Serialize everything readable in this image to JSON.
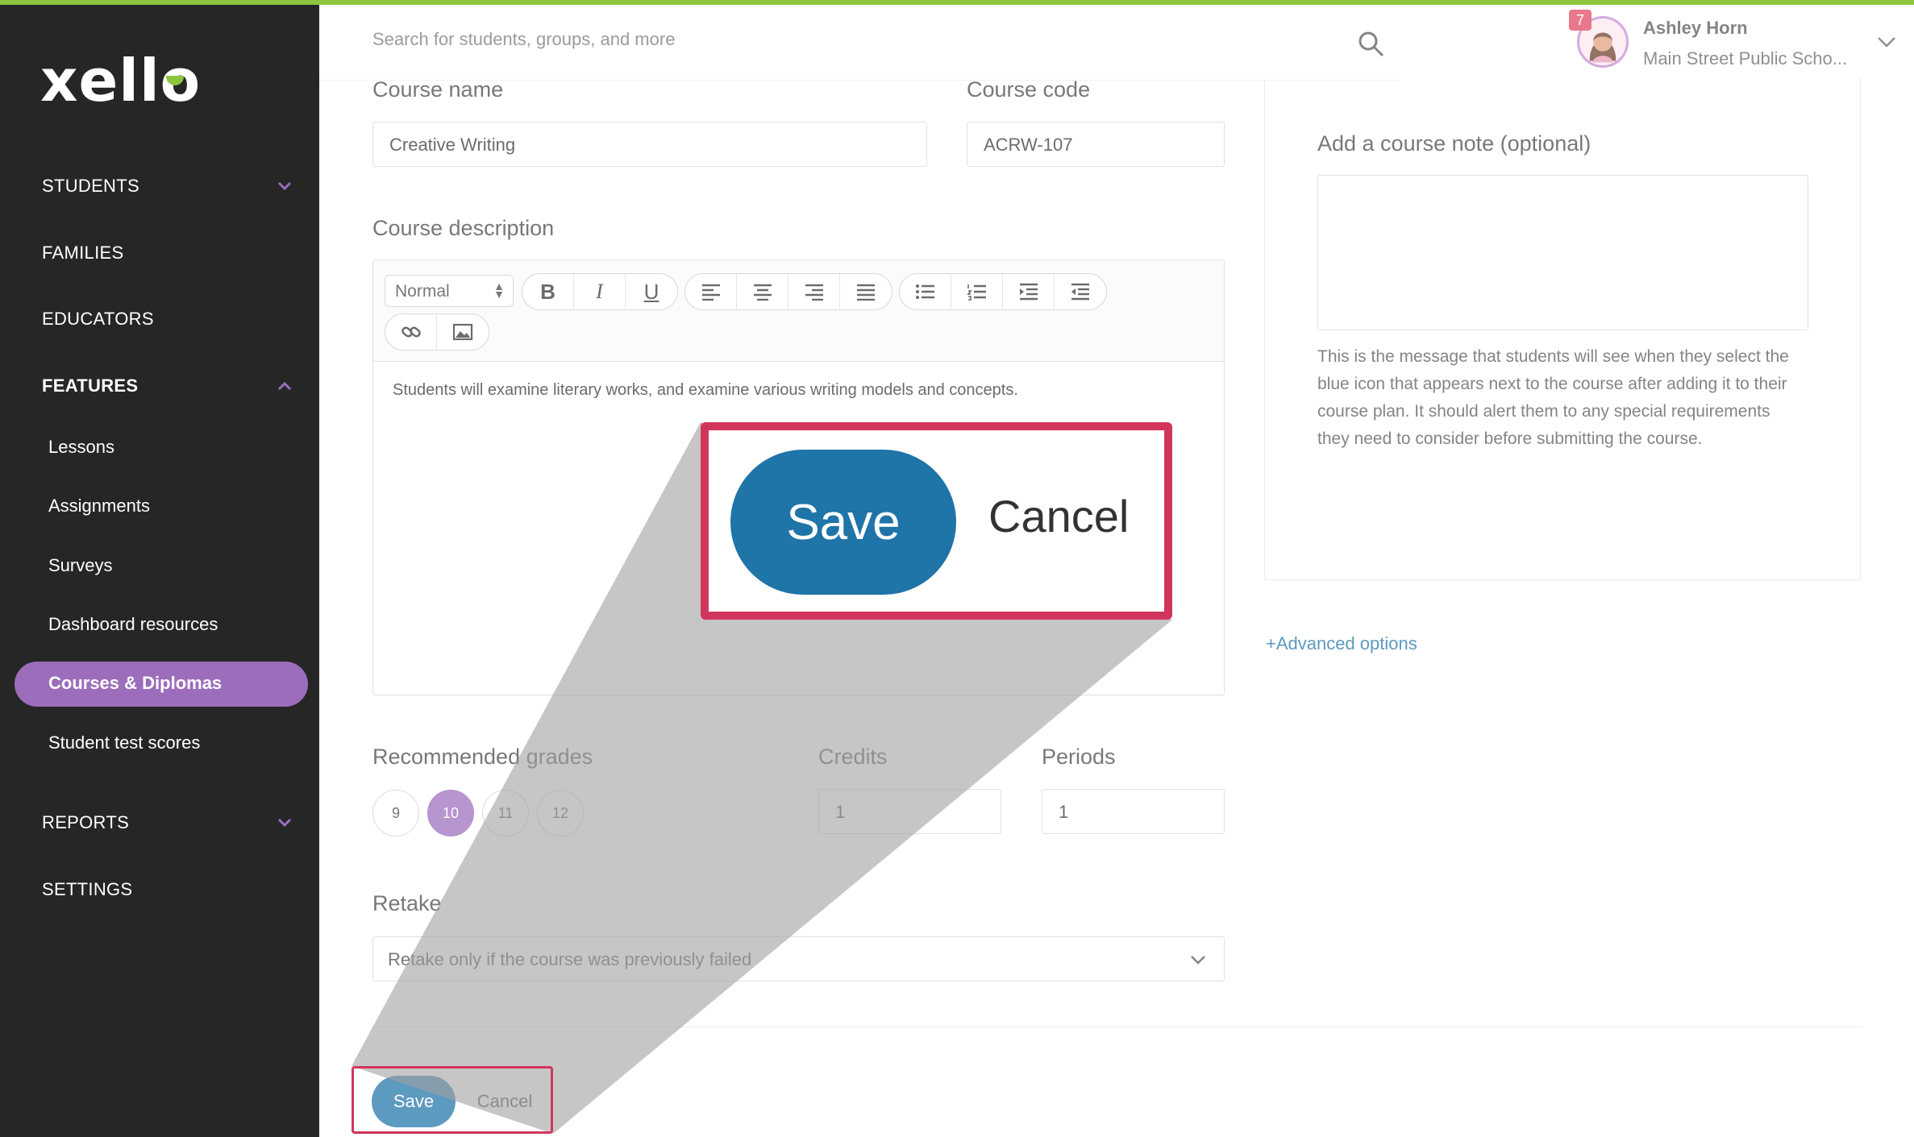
{
  "app": {
    "logo": "xello"
  },
  "search": {
    "placeholder": "Search for students, groups, and more"
  },
  "user": {
    "name": "Ashley Horn",
    "school": "Main Street Public Scho...",
    "notifications": "7"
  },
  "sidebar": {
    "sections": {
      "students": "STUDENTS",
      "families": "FAMILIES",
      "educators": "EDUCATORS",
      "features": "FEATURES",
      "reports": "REPORTS",
      "settings": "SETTINGS"
    },
    "features_items": [
      "Lessons",
      "Assignments",
      "Surveys",
      "Dashboard resources",
      "Courses & Diplomas",
      "Student test scores"
    ],
    "active_item": "Courses & Diplomas"
  },
  "form": {
    "course_name_label": "Course name",
    "course_name_value": "Creative Writing",
    "course_code_label": "Course code",
    "course_code_value": "ACRW-107",
    "description_label": "Course description",
    "toolbar_style": "Normal",
    "description_text": "Students will examine literary works, and examine various writing models and concepts.",
    "grades_label": "Recommended grades",
    "grades": [
      "9",
      "10",
      "11",
      "12"
    ],
    "selected_grade": "10",
    "credits_label": "Credits",
    "credits_value": "1",
    "periods_label": "Periods",
    "periods_value": "1",
    "retake_label": "Retake",
    "retake_value": "Retake only if the course was previously failed",
    "save_label": "Save",
    "cancel_label": "Cancel"
  },
  "note": {
    "label": "Add a course note (optional)",
    "help": "This is the message that students will see when they select the blue icon that appears next to the course after adding it to their course plan. It should alert them to any special requirements they need to consider before submitting the course.",
    "advanced": "+Advanced options"
  },
  "callout": {
    "save": "Save",
    "cancel": "Cancel"
  },
  "colors": {
    "accent_purple": "#9b6dbb",
    "save_blue": "#1f74a8",
    "highlight": "#d2355c",
    "brand_green": "#8cc63f",
    "sidebar_bg": "#262626"
  }
}
